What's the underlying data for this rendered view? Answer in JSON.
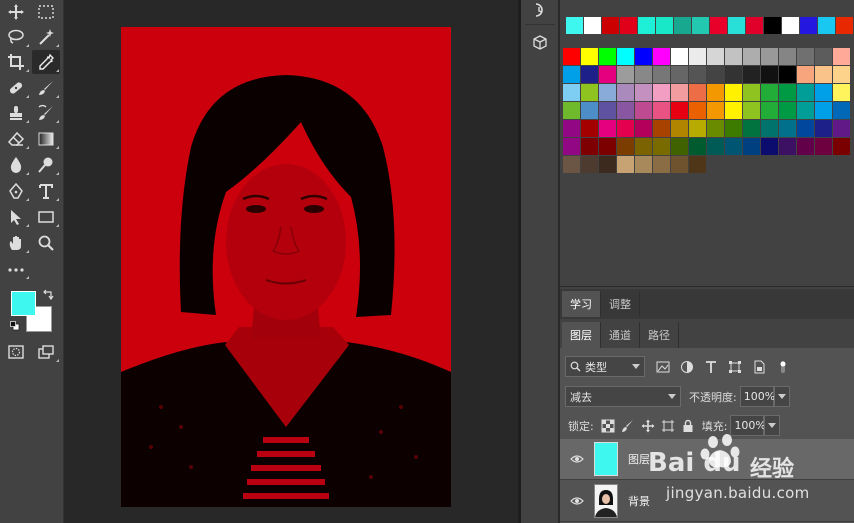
{
  "tools": {
    "foreground_color": "#3ef7ef",
    "background_color": "#ffffff"
  },
  "swatches": {
    "recent": [
      "#3ef7ef",
      "#ffffff",
      "#cc0000",
      "#e0001a",
      "#1ef0d8",
      "#18e8c8",
      "#18a890",
      "#22c8b0",
      "#e8002a",
      "#28e0d8",
      "#e0002a",
      "#000000",
      "#ffffff",
      "#2418e0",
      "#18c8f0",
      "#e82800"
    ],
    "rows": [
      [
        "#ff0000",
        "#ffff00",
        "#00ff00",
        "#00ffff",
        "#0000ff",
        "#ff00ff",
        "#ffffff",
        "#ebebeb",
        "#d6d6d6",
        "#c2c2c2",
        "#adadad",
        "#999999",
        "#858585",
        "#707070",
        "#5c5c5c",
        "#ffaa99"
      ],
      [
        "#00a0e9",
        "#1d2088",
        "#e4007f",
        "#9c9c9c",
        "#888888",
        "#777777",
        "#666666",
        "#555555",
        "#444444",
        "#333333",
        "#222222",
        "#111111",
        "#000000",
        "#f7a57c",
        "#f9c38a",
        "#fdd38c"
      ],
      [
        "#7ecef4",
        "#8fc31f",
        "#88abda",
        "#aa89bd",
        "#c490bf",
        "#f19ec2",
        "#f29c9f",
        "#ed6d46",
        "#f39800",
        "#fff100",
        "#8fc31f",
        "#22ac38",
        "#009944",
        "#009e96",
        "#00a0e9",
        "#fff45c"
      ],
      [
        "#6fba2c",
        "#4d8ec8",
        "#5f52a0",
        "#8957a1",
        "#be4b91",
        "#e85383",
        "#e60012",
        "#eb6100",
        "#f39800",
        "#fff100",
        "#8fc31f",
        "#22ac38",
        "#009944",
        "#009e96",
        "#00a0e9",
        "#0068b7"
      ],
      [
        "#920783",
        "#a40000",
        "#e4007f",
        "#e5004f",
        "#b5005b",
        "#a84200",
        "#b28500",
        "#b7aa00",
        "#6a8a00",
        "#3d7a00",
        "#00733e",
        "#00736d",
        "#00708c",
        "#00479d",
        "#1d2088",
        "#601986"
      ],
      [
        "#920783",
        "#7f0000",
        "#7d0000",
        "#7b3d00",
        "#7a6300",
        "#7a6b00",
        "#406200",
        "#005c2f",
        "#005a55",
        "#005672",
        "#003f80",
        "#0c0c6e",
        "#3c1163",
        "#63004a",
        "#6e0040",
        "#7a0000"
      ],
      [
        "#6b5544",
        "#4e3b2f",
        "#3c2a1e",
        "#c7a272",
        "#a8895c",
        "#8a6d44",
        "#6f522e",
        "#4f3619"
      ]
    ]
  },
  "learn_tabs": [
    {
      "label": "学习"
    },
    {
      "label": "调整"
    }
  ],
  "layers_tabs": [
    {
      "label": "图层"
    },
    {
      "label": "通道"
    },
    {
      "label": "路径"
    }
  ],
  "layers": {
    "filter_kind": "类型",
    "blend_mode": "减去",
    "opacity_label": "不透明度:",
    "opacity_value": "100%",
    "lock_label": "锁定:",
    "fill_label": "填充:",
    "fill_value": "100%",
    "items": [
      {
        "name": "图层",
        "selected": true,
        "thumb_color": "#3ef7ef"
      },
      {
        "name": "背景",
        "selected": false
      }
    ]
  },
  "watermark": {
    "logo": "Bai  du",
    "cn": "经验",
    "url": "jingyan.baidu.com"
  }
}
